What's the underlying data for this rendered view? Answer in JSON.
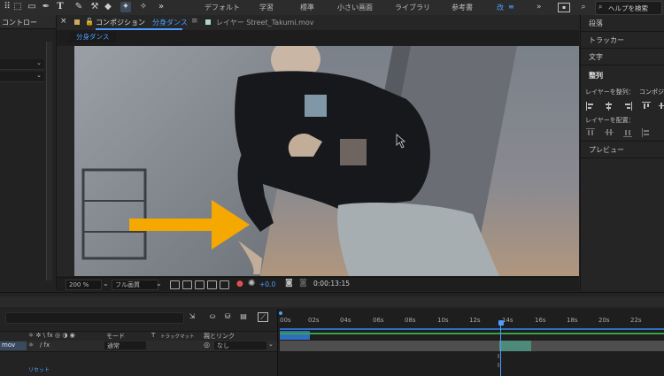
{
  "toolbar": {
    "workspaces": [
      "デフォルト",
      "学習",
      "標準",
      "小さい画面",
      "ライブラリ",
      "参考書",
      "改",
      "≡"
    ],
    "help_placeholder": "ヘルプを検索"
  },
  "left_panel": {
    "title": "コントロー"
  },
  "comp_panel": {
    "tab_comp_label": "コンポジション",
    "tab_comp_name": "分身ダンス",
    "tab_layer_label": "レイヤー Street_Takumi.mov",
    "breadcrumb": "分身ダンス",
    "zoom": "200 %",
    "quality": "フル画質",
    "exposure": "+0.0",
    "timecode": "0:00:13:15"
  },
  "right_panel": {
    "items": [
      "段落",
      "トラッカー",
      "文字",
      "整列"
    ],
    "align_to_label": "レイヤーを整列：",
    "align_to_value": "コンポジシ",
    "distribute_label": "レイヤーを配置：",
    "preview": "プレビュー"
  },
  "timeline": {
    "ticks": [
      "00s",
      "02s",
      "04s",
      "06s",
      "08s",
      "10s",
      "12s",
      "14s",
      "16s",
      "18s",
      "20s",
      "22s"
    ],
    "col_mode": "モード",
    "col_t": "T",
    "col_trackmatte": "トラックマット",
    "col_parent": "親とリンク",
    "layer_name": "mov",
    "layer_mode": "通常",
    "layer_parent": "なし",
    "reset": "リセット"
  },
  "colors": {
    "accent": "#4d9dff",
    "arrow": "#f5a800",
    "clip": "#4e8a7a",
    "workarea": "#2f6fbf"
  }
}
